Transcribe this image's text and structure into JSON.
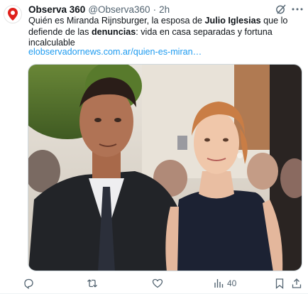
{
  "author": {
    "name": "Observa 360",
    "handle": "@Observa360",
    "separator": "·",
    "time": "2h",
    "avatar_color": "#e0201b"
  },
  "tweet": {
    "text_1": "Quién es Miranda Rijnsburger, la esposa de ",
    "bold_1": "Julio Iglesias",
    "text_2": " que lo defiende de las ",
    "bold_2": "denuncias",
    "text_3": ": vida en casa separadas y fortuna incalculable",
    "link": "elobservadornews.com.ar/quien-es-miran…"
  },
  "actions": {
    "reply_icon": "reply-icon",
    "retweet_icon": "retweet-icon",
    "like_icon": "heart-icon",
    "views_icon": "views-chart-icon",
    "views_count": "40",
    "bookmark_icon": "bookmark-icon",
    "share_icon": "share-icon",
    "icon_color": "#536471"
  },
  "colors": {
    "link": "#1d9bf0",
    "text": "#0f1419",
    "muted": "#536471"
  }
}
